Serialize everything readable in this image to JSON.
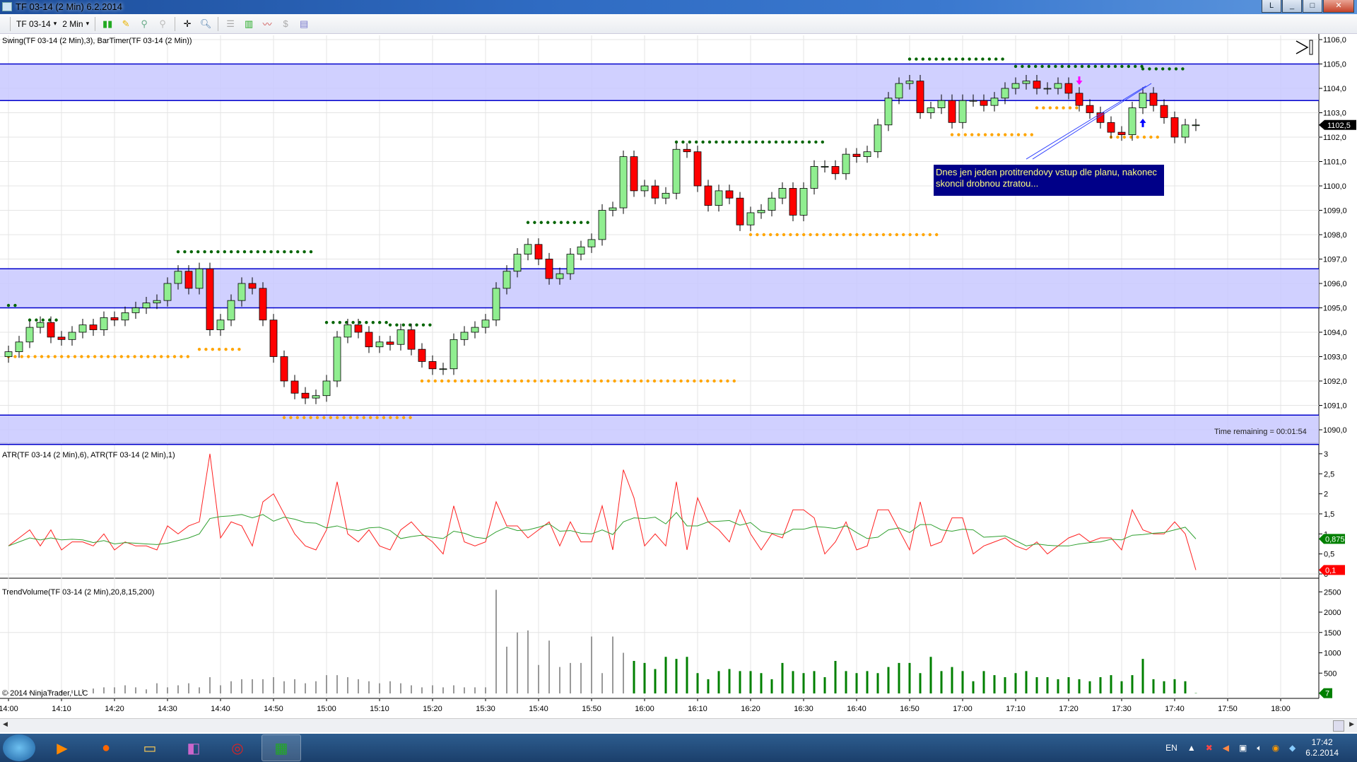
{
  "window": {
    "title": "TF 03-14 (2 Min)  6.2.2014",
    "min": "_",
    "max": "□",
    "close": "✕",
    "restore": "L"
  },
  "toolbar": {
    "instrument": "TF 03-14",
    "interval": "2 Min"
  },
  "panels": {
    "price_label": "Swing(TF 03-14 (2 Min),3), BarTimer(TF 03-14 (2 Min))",
    "atr_label": "ATR(TF 03-14 (2 Min),6), ATR(TF 03-14 (2 Min),1)",
    "volume_label": "TrendVolume(TF 03-14 (2 Min),20,8,15,200)",
    "copyright": "© 2014 NinjaTrader, LLC",
    "time_remaining": "Time remaining = 00:01:54",
    "note": "Dnes jen jeden protitrendovy vstup dle planu, nakonec skoncil drobnou ztratou..."
  },
  "colors": {
    "up": "#90ee90",
    "down": "#ff0000",
    "zone": "#c8c8ff",
    "zone_line": "#0000cc",
    "swing_high": "#006400",
    "swing_low": "#ffa500",
    "atr1": "#ff2020",
    "atr6": "#30a030",
    "vol_grey": "#999999",
    "vol_green": "#008000"
  },
  "chart_data": [
    {
      "type": "candlestick",
      "title": "TF 03-14 (2 Min)",
      "ylim": [
        1089.4,
        1106.0
      ],
      "y_ticks": [
        "1106,0",
        "1105,0",
        "1104,0",
        "1103,0",
        "1102,0",
        "1101,0",
        "1100,0",
        "1099,0",
        "1098,0",
        "1097,0",
        "1096,0",
        "1095,0",
        "1094,0",
        "1093,0",
        "1092,0",
        "1091,0",
        "1090,0"
      ],
      "last_price": "1102,5",
      "x_ticks": [
        "14:00",
        "14:10",
        "14:20",
        "14:30",
        "14:40",
        "14:50",
        "15:00",
        "15:10",
        "15:20",
        "15:30",
        "15:40",
        "15:50",
        "16:00",
        "16:10",
        "16:20",
        "16:30",
        "16:40",
        "16:50",
        "17:00",
        "17:10",
        "17:20",
        "17:30",
        "17:40",
        "17:50",
        "18:00"
      ],
      "first_open": 1093.0,
      "close": [
        1093.2,
        1093.6,
        1094.2,
        1094.4,
        1093.8,
        1093.7,
        1094.0,
        1094.3,
        1094.1,
        1094.6,
        1094.5,
        1094.8,
        1095.0,
        1095.2,
        1095.3,
        1096.0,
        1096.5,
        1095.8,
        1096.6,
        1094.1,
        1094.5,
        1095.3,
        1096.0,
        1095.8,
        1094.5,
        1093.0,
        1092.0,
        1091.5,
        1091.3,
        1091.4,
        1092.0,
        1093.8,
        1094.3,
        1094.0,
        1093.4,
        1093.6,
        1093.5,
        1094.1,
        1093.3,
        1092.8,
        1092.5,
        1092.5,
        1093.7,
        1094.0,
        1094.2,
        1094.5,
        1095.8,
        1096.5,
        1097.2,
        1097.6,
        1097.0,
        1096.2,
        1096.4,
        1097.2,
        1097.5,
        1097.8,
        1099.0,
        1099.1,
        1101.2,
        1099.8,
        1100.0,
        1099.5,
        1099.7,
        1101.5,
        1101.4,
        1100.0,
        1099.2,
        1099.8,
        1099.5,
        1098.4,
        1098.9,
        1099.0,
        1099.5,
        1099.9,
        1098.8,
        1099.9,
        1100.8,
        1100.8,
        1100.5,
        1101.3,
        1101.2,
        1101.4,
        1102.5,
        1103.6,
        1104.2,
        1104.3,
        1103.0,
        1103.2,
        1103.5,
        1102.6,
        1103.5,
        1103.5,
        1103.3,
        1103.6,
        1104.0,
        1104.2,
        1104.3,
        1104.0,
        1104.0,
        1104.2,
        1103.8,
        1103.3,
        1103.0,
        1102.6,
        1102.2,
        1102.1,
        1103.2,
        1103.8,
        1103.3,
        1102.8,
        1102.0,
        1102.5,
        1102.5
      ],
      "zones": [
        [
          1103.5,
          1105.0
        ],
        [
          1095.0,
          1096.6
        ],
        [
          1089.4,
          1090.6
        ]
      ],
      "swing_highs": [
        [
          0,
          1,
          1095.1
        ],
        [
          2,
          5,
          1094.5
        ],
        [
          16,
          29,
          1097.3
        ],
        [
          30,
          36,
          1094.4
        ],
        [
          36,
          40,
          1094.3
        ],
        [
          49,
          55,
          1098.5
        ],
        [
          63,
          77,
          1101.8
        ],
        [
          85,
          94,
          1105.2
        ],
        [
          95,
          107,
          1104.9
        ],
        [
          107,
          111,
          1104.8
        ]
      ],
      "swing_lows": [
        [
          0,
          17,
          1093.0
        ],
        [
          18,
          22,
          1093.3
        ],
        [
          26,
          38,
          1090.5
        ],
        [
          39,
          69,
          1092.0
        ],
        [
          70,
          88,
          1098.0
        ],
        [
          89,
          97,
          1102.1
        ],
        [
          97,
          101,
          1103.2
        ],
        [
          104,
          109,
          1102.0
        ]
      ],
      "arrows": [
        {
          "bar": 101,
          "price": 1104.2,
          "dir": "down",
          "color": "#ff00ff"
        },
        {
          "bar": 107,
          "price": 1102.7,
          "dir": "up",
          "color": "#0000ff"
        }
      ],
      "trend_lines": [
        [
          96,
          1101.1,
          107.3,
          1104.1
        ],
        [
          96.6,
          1101.1,
          107.8,
          1104.2
        ]
      ]
    },
    {
      "type": "line",
      "title": "ATR",
      "ylim": [
        0,
        3.2
      ],
      "y_ticks": [
        "3",
        "2,5",
        "2",
        "1,5",
        "1",
        "0,5",
        "0"
      ],
      "series": [
        {
          "name": "ATR(6)",
          "last": "0,875"
        },
        {
          "name": "ATR(1)",
          "last": "0,1"
        }
      ]
    },
    {
      "type": "bar",
      "title": "TrendVolume",
      "ylim": [
        0,
        2700
      ],
      "y_ticks": [
        "2500",
        "2000",
        "1500",
        "1000",
        "500"
      ],
      "last": "7",
      "green_from": 59,
      "values": [
        20,
        30,
        40,
        30,
        50,
        60,
        80,
        100,
        120,
        150,
        150,
        200,
        150,
        100,
        250,
        150,
        200,
        250,
        150,
        400,
        200,
        300,
        350,
        350,
        350,
        400,
        300,
        350,
        250,
        300,
        450,
        450,
        400,
        350,
        300,
        250,
        300,
        250,
        200,
        150,
        200,
        150,
        200,
        150,
        150,
        150,
        2550,
        1150,
        1500,
        1550,
        700,
        1300,
        650,
        750,
        750,
        1400,
        500,
        1400,
        1000,
        800,
        750,
        600,
        900,
        850,
        900,
        500,
        350,
        550,
        600,
        550,
        550,
        500,
        350,
        750,
        550,
        500,
        550,
        400,
        800,
        550,
        500,
        550,
        500,
        650,
        750,
        750,
        500,
        900,
        550,
        650,
        550,
        300,
        550,
        450,
        400,
        500,
        550,
        400,
        400,
        350,
        400,
        350,
        300,
        400,
        450,
        300,
        450,
        850,
        350,
        300,
        350,
        300,
        7
      ]
    }
  ],
  "taskbar": {
    "lang": "EN",
    "time": "17:42",
    "date": "6.2.2014"
  }
}
